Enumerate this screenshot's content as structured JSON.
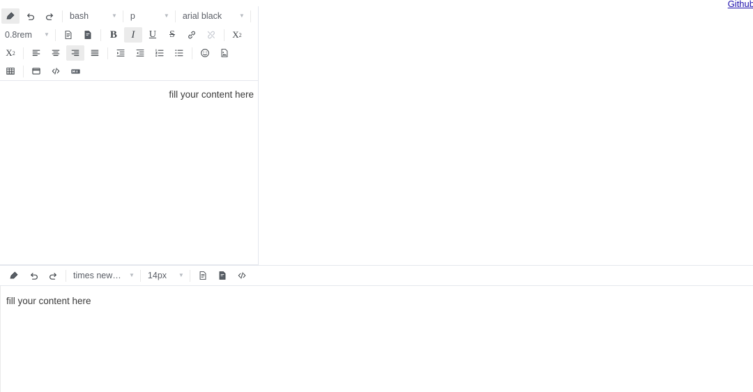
{
  "page": {
    "github_link": "Github"
  },
  "editor1": {
    "toolbar_rows": [
      {
        "row": 1,
        "items": [
          {
            "name": "eraser-icon",
            "label": "",
            "kind": "icon",
            "state": "active"
          },
          {
            "name": "undo-icon",
            "label": "",
            "kind": "icon",
            "state": "normal"
          },
          {
            "name": "redo-icon",
            "label": "",
            "kind": "icon",
            "state": "normal"
          },
          {
            "name": "language-select",
            "label": "bash",
            "kind": "select",
            "state": "normal"
          },
          {
            "name": "paragraph-format-select",
            "label": "p",
            "kind": "select",
            "state": "normal"
          },
          {
            "name": "font-family-select",
            "label": "arial black",
            "kind": "select",
            "state": "normal"
          }
        ]
      },
      {
        "row": 2,
        "items": [
          {
            "name": "font-size-select",
            "label": "0.8rem",
            "kind": "select",
            "state": "normal"
          },
          {
            "name": "text-color-icon",
            "label": "",
            "kind": "icon",
            "state": "normal"
          },
          {
            "name": "background-color-icon",
            "label": "",
            "kind": "icon",
            "state": "normal"
          },
          {
            "name": "bold-button",
            "label": "B",
            "kind": "text",
            "state": "normal"
          },
          {
            "name": "italic-button",
            "label": "I",
            "kind": "text",
            "state": "active"
          },
          {
            "name": "underline-button",
            "label": "U",
            "kind": "text",
            "state": "normal"
          },
          {
            "name": "strikethrough-button",
            "label": "S",
            "kind": "text",
            "state": "normal"
          },
          {
            "name": "link-icon",
            "label": "",
            "kind": "icon",
            "state": "normal"
          },
          {
            "name": "unlink-icon",
            "label": "",
            "kind": "icon",
            "state": "disabled"
          },
          {
            "name": "subscript-button",
            "label": "X2",
            "kind": "text",
            "state": "normal"
          }
        ]
      },
      {
        "row": 3,
        "items": [
          {
            "name": "superscript-button",
            "label": "X2",
            "kind": "text",
            "state": "normal"
          },
          {
            "name": "align-left-icon",
            "label": "",
            "kind": "icon",
            "state": "normal"
          },
          {
            "name": "align-center-icon",
            "label": "",
            "kind": "icon",
            "state": "normal"
          },
          {
            "name": "align-right-icon",
            "label": "",
            "kind": "icon",
            "state": "active"
          },
          {
            "name": "align-justify-icon",
            "label": "",
            "kind": "icon",
            "state": "normal"
          },
          {
            "name": "indent-icon",
            "label": "",
            "kind": "icon",
            "state": "normal"
          },
          {
            "name": "outdent-icon",
            "label": "",
            "kind": "icon",
            "state": "normal"
          },
          {
            "name": "ordered-list-icon",
            "label": "",
            "kind": "icon",
            "state": "normal"
          },
          {
            "name": "unordered-list-icon",
            "label": "",
            "kind": "icon",
            "state": "normal"
          },
          {
            "name": "emoji-icon",
            "label": "",
            "kind": "icon",
            "state": "normal"
          },
          {
            "name": "insert-image-icon",
            "label": "",
            "kind": "icon",
            "state": "normal"
          }
        ]
      },
      {
        "row": 4,
        "items": [
          {
            "name": "table-icon",
            "label": "",
            "kind": "icon",
            "state": "normal"
          },
          {
            "name": "fullscreen-icon",
            "label": "",
            "kind": "icon",
            "state": "normal"
          },
          {
            "name": "source-code-icon",
            "label": "",
            "kind": "icon",
            "state": "normal"
          },
          {
            "name": "markdown-icon",
            "label": "",
            "kind": "icon",
            "state": "normal"
          }
        ]
      }
    ],
    "content": "fill your content here"
  },
  "editor2": {
    "toolbar_items": [
      {
        "name": "eraser-icon",
        "label": "",
        "kind": "icon",
        "state": "normal"
      },
      {
        "name": "undo-icon",
        "label": "",
        "kind": "icon",
        "state": "normal"
      },
      {
        "name": "redo-icon",
        "label": "",
        "kind": "icon",
        "state": "normal"
      },
      {
        "name": "font-family-select",
        "label": "times new r...",
        "kind": "select",
        "state": "normal"
      },
      {
        "name": "font-size-select",
        "label": "14px",
        "kind": "select",
        "state": "normal"
      },
      {
        "name": "text-color-icon",
        "label": "",
        "kind": "icon",
        "state": "normal"
      },
      {
        "name": "background-color-icon",
        "label": "",
        "kind": "icon",
        "state": "normal"
      },
      {
        "name": "source-code-icon",
        "label": "",
        "kind": "icon",
        "state": "normal"
      }
    ],
    "content": "fill your content here"
  },
  "colors": {
    "border": "#e4e7ed",
    "icon": "#41464b",
    "active_bg": "#ebebeb",
    "disabled": "#c0c4cc",
    "link": "#1a0dab",
    "text": "#3a3a3a"
  }
}
